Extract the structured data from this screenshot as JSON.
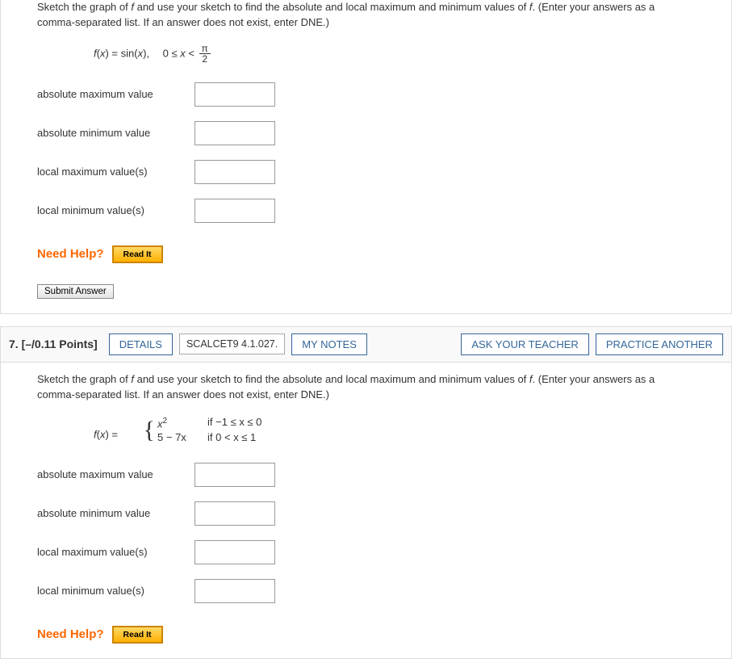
{
  "q1": {
    "prompt1": "Sketch the graph of ",
    "prompt_f1": "f",
    "prompt2": " and use your sketch to find the absolute and local maximum and minimum values of ",
    "prompt_f2": "f",
    "prompt3": ". (Enter your answers as a comma-separated list. If an answer does not exist, enter DNE.)",
    "func_lhs": "f",
    "func_lparen": "(",
    "func_var": "x",
    "func_rparen_eq": ") = sin(",
    "func_var2": "x",
    "func_close": "),  0 ≤ ",
    "func_var3": "x",
    "func_lt": " < ",
    "frac_num": "π",
    "frac_den": "2",
    "labels": {
      "absmax": "absolute maximum value",
      "absmin": "absolute minimum value",
      "locmax": "local maximum value(s)",
      "locmin": "local minimum value(s)"
    },
    "need_help": "Need Help?",
    "read_it": "Read It",
    "submit": "Submit Answer"
  },
  "q2": {
    "header": {
      "number": "7.",
      "points": "[–/0.11 Points]",
      "details": "DETAILS",
      "ref": "SCALCET9 4.1.027.",
      "mynotes": "MY NOTES",
      "ask": "ASK YOUR TEACHER",
      "practice": "PRACTICE ANOTHER"
    },
    "prompt1": "Sketch the graph of ",
    "prompt_f1": "f",
    "prompt2": " and use your sketch to find the absolute and local maximum and minimum values of ",
    "prompt_f2": "f",
    "prompt3": ". (Enter your answers as a comma-separated list. If an answer does not exist, enter DNE.)",
    "pw_lhs": "f",
    "pw_lparen": "(",
    "pw_var": "x",
    "pw_rparen_eq": ") = ",
    "pw_r1_expr_a": "x",
    "pw_r1_expr_sup": "2",
    "pw_r1_cond": "if −1 ≤ x ≤ 0",
    "pw_r2_expr": "5 − 7x",
    "pw_r2_cond": "if 0 < x ≤ 1",
    "labels": {
      "absmax": "absolute maximum value",
      "absmin": "absolute minimum value",
      "locmax": "local maximum value(s)",
      "locmin": "local minimum value(s)"
    },
    "need_help": "Need Help?",
    "read_it": "Read It"
  }
}
